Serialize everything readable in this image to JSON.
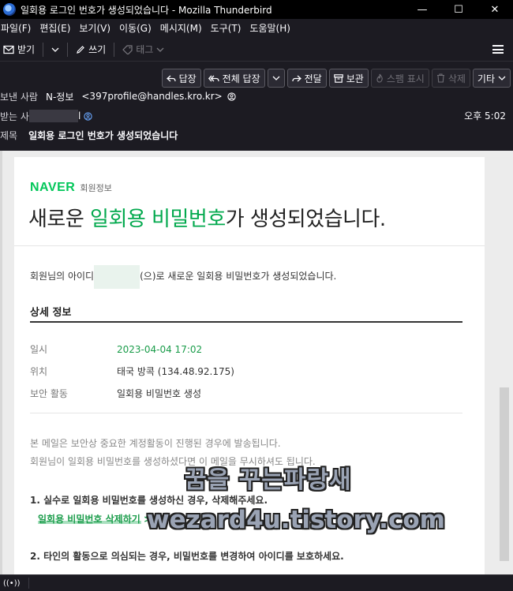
{
  "window": {
    "title": "일회용 로그인 번호가 생성되었습니다 - Mozilla Thunderbird",
    "minimize": "—",
    "maximize": "☐",
    "close": "✕"
  },
  "menu": [
    "파일(F)",
    "편집(E)",
    "보기(V)",
    "이동(G)",
    "메시지(M)",
    "도구(T)",
    "도움말(H)"
  ],
  "toolbar": {
    "get_mail": "받기",
    "write": "쓰기",
    "tag": "태그"
  },
  "actions": {
    "reply": "답장",
    "reply_all": "전체 답장",
    "forward": "전달",
    "archive": "보관",
    "junk": "스팸 표시",
    "delete": "삭제",
    "other": "기타"
  },
  "header": {
    "from_label": "보낸 사람",
    "from_name": "N-정보",
    "from_email": "<397profile@handles.kro.kr>",
    "to_label": "받는 사",
    "to_suffix": "l",
    "time": "오후 5:02",
    "subject_label": "제목",
    "subject": "일회용 로그인 번호가 생성되었습니다"
  },
  "mail": {
    "brand": "NAVER",
    "brand_sub": "회원정보",
    "headline_pre": "새로운 ",
    "headline_green": "일회용 비밀번호",
    "headline_post": "가 생성되었습니다.",
    "lead_pre": "회원님의 아이디",
    "lead_post": "(으)로 새로운 일회용 비밀번호가 생성되었습니다.",
    "detail_title": "상세 정보",
    "details": [
      {
        "key": "일시",
        "value": "2023-04-04 17:02"
      },
      {
        "key": "위치",
        "value": "태국 방콕 (134.48.92.175)"
      },
      {
        "key": "보안 활동",
        "value": "일회용 비밀번호 생성"
      }
    ],
    "notice1": "본 메일은 보안상 중요한 계정활동이 진행된 경우에 발송됩니다.",
    "notice2": "회원님이 일회용 비밀번호를 생성하셨다면 이 메일을 무시하셔도 됩니다.",
    "step1": "1. 실수로 일회용 비밀번호를 생성하신 경우, 삭제해주세요.",
    "link1": "일회용 비밀번호 삭제하기 >",
    "step2": "2. 타인의 활동으로 의심되는 경우, 비밀번호를 변경하여 아이디를 보호하세요."
  },
  "watermark": {
    "line1": "꿈을 꾸는파랑새",
    "line2": "wezard4u.tistory.com"
  },
  "status": {
    "icon": "((•))"
  },
  "colors": {
    "naver_green": "#03c75a",
    "chrome_bg": "#1c1b22"
  }
}
